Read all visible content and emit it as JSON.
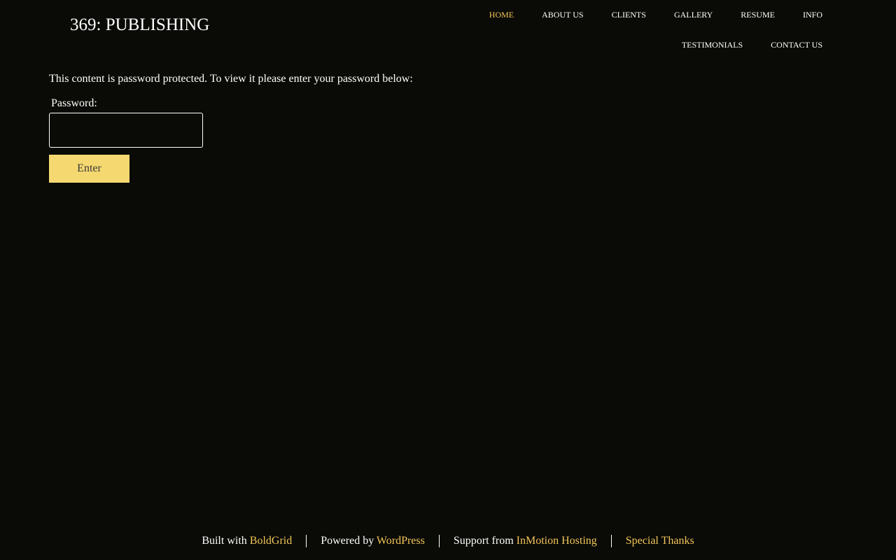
{
  "header": {
    "site_title": "369: PUBLISHING"
  },
  "nav": {
    "row1": [
      {
        "label": "HOME",
        "active": true
      },
      {
        "label": "ABOUT US",
        "active": false
      },
      {
        "label": "CLIENTS",
        "active": false
      },
      {
        "label": "GALLERY",
        "active": false
      },
      {
        "label": "RESUME",
        "active": false
      },
      {
        "label": "INFO",
        "active": false
      }
    ],
    "row2": [
      {
        "label": "TESTIMONIALS",
        "active": false
      },
      {
        "label": "CONTACT US",
        "active": false
      }
    ]
  },
  "main": {
    "notice": "This content is password protected. To view it please enter your password below:",
    "password_label": "Password:",
    "password_value": "",
    "enter_label": "Enter"
  },
  "footer": {
    "built_with_text": "Built with",
    "built_with_link": "BoldGrid",
    "powered_by_text": "Powered by",
    "powered_by_link": "WordPress",
    "support_text": "Support from",
    "support_link": "InMotion Hosting",
    "special_thanks": "Special Thanks"
  },
  "colors": {
    "background": "#0a0a06",
    "accent": "#f2c659",
    "button": "#f5d870",
    "text": "#ffffff"
  }
}
